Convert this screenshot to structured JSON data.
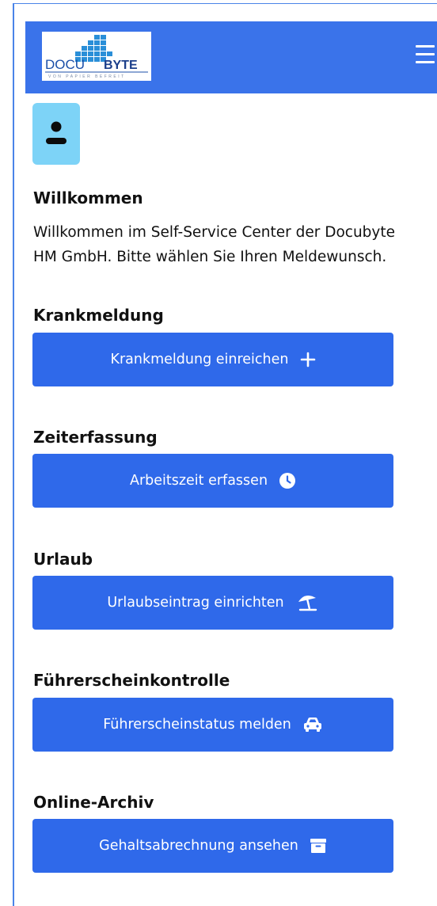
{
  "header": {
    "logo_text_left": "DOCU",
    "logo_text_right": "BYTE",
    "logo_tagline": "VON PAPIER BEFREIT",
    "menu_icon": "hamburger-menu-icon"
  },
  "avatar": {
    "icon": "user-icon"
  },
  "welcome": {
    "title": "Willkommen",
    "line1": "Willkommen im Self-Service Center der Docubyte",
    "line2": "HM GmbH. Bitte wählen Sie Ihren Meldewunsch."
  },
  "sections": [
    {
      "title": "Krankmeldung",
      "button_label": "Krankmeldung einreichen",
      "icon": "plus-icon"
    },
    {
      "title": "Zeiterfassung",
      "button_label": "Arbeitszeit erfassen",
      "icon": "clock-icon"
    },
    {
      "title": "Urlaub",
      "button_label": "Urlaubseintrag einrichten",
      "icon": "umbrella-beach-icon"
    },
    {
      "title": "Führerscheinkontrolle",
      "button_label": "Führerscheinstatus melden",
      "icon": "car-icon"
    },
    {
      "title": "Online-Archiv",
      "button_label": "Gehaltsabrechnung ansehen",
      "icon": "archive-box-icon"
    }
  ],
  "colors": {
    "header_bg": "#3a73ea",
    "button_bg": "#2f69ea",
    "avatar_bg": "#7dd3f7"
  }
}
